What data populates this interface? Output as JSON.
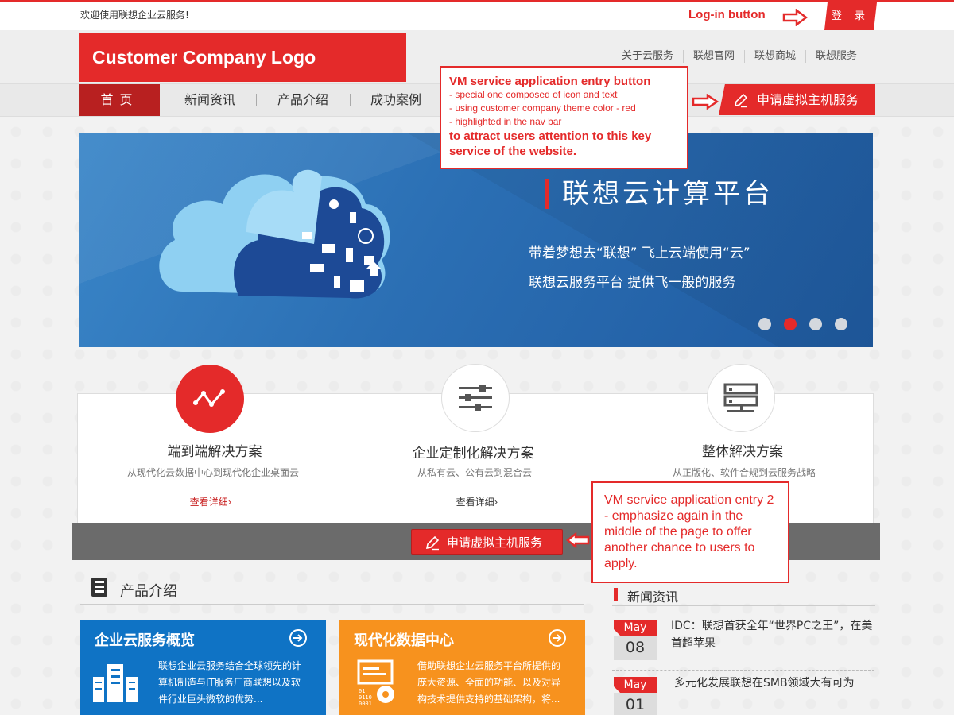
{
  "topbar": {
    "welcome": "欢迎使用联想企业云服务!",
    "login_annotation": "Log-in button",
    "login_label": "登 录"
  },
  "header": {
    "logo": "Customer Company Logo",
    "links": [
      "关于云服务",
      "联想官网",
      "联想商城",
      "联想服务"
    ]
  },
  "nav": {
    "items": [
      "首页",
      "新闻资讯",
      "产品介绍",
      "成功案例"
    ],
    "vm_button": "申请虚拟主机服务"
  },
  "annotation1": {
    "heading": "VM service application entry button",
    "lines": [
      "- special one composed of icon and text",
      "- using customer company theme color - red",
      "- highlighted in the nav bar"
    ],
    "bold": "to attract users attention to this key service of the website."
  },
  "banner": {
    "title": "联想云计算平台",
    "line1": "带着梦想去“联想” 飞上云端使用“云”",
    "line2": "联想云服务平台 提供飞一般的服务",
    "active_dot": 1,
    "dot_count": 4
  },
  "solutions": [
    {
      "title": "端到端解决方案",
      "subtitle": "从现代化云数据中心到现代化企业桌面云",
      "link": "查看详细",
      "icon": "line-chart-icon"
    },
    {
      "title": "企业定制化解决方案",
      "subtitle": "从私有云、公有云到混合云",
      "link": "查看详细",
      "icon": "sliders-icon"
    },
    {
      "title": "整体解决方案",
      "subtitle": "从正版化、软件合规到云服务战略",
      "link": "查看详细",
      "icon": "server-icon"
    }
  ],
  "mid_button": "申请虚拟主机服务",
  "annotation2": "VM service application entry 2 - emphasize again in the middle of the page to offer another chance to users to apply.",
  "products": {
    "title": "产品介绍",
    "cards": [
      {
        "title": "企业云服务概览",
        "text": "联想企业云服务结合全球领先的计算机制造与IT服务厂商联想以及软件行业巨头微软的优势...",
        "color": "#0f73c5"
      },
      {
        "title": "现代化数据中心",
        "text": "借助联想企业云服务平台所提供的庞大资源、全面的功能、以及对异构技术提供支持的基础架构，将...",
        "color": "#f7921e"
      }
    ]
  },
  "news": {
    "title": "新闻资讯",
    "items": [
      {
        "month": "May",
        "day": "08",
        "text": "IDC：联想首获全年“世界PC之王”，在美首超苹果"
      },
      {
        "month": "May",
        "day": "01",
        "text": "多元化发展联想在SMB领域大有可为"
      }
    ]
  },
  "colors": {
    "brand": "#e42a2a",
    "blue": "#0f73c5",
    "orange": "#f7921e"
  }
}
